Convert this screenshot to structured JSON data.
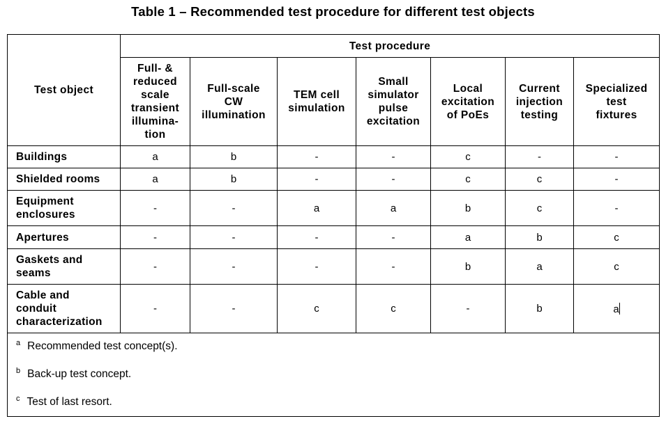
{
  "title": "Table 1 – Recommended test procedure for different test objects",
  "table": {
    "row_header_label": "Test object",
    "group_header_label": "Test procedure",
    "columns": [
      "Full- & reduced scale transient illumina-tion",
      "Full-scale CW illumination",
      "TEM cell simulation",
      "Small simulator pulse excitation",
      "Local excitation of PoEs",
      "Current injection testing",
      "Specialized test fixtures"
    ],
    "column_lines": [
      [
        "Full- &",
        "reduced",
        "scale",
        "transient",
        "illumina-",
        "tion"
      ],
      [
        "Full-scale",
        "CW",
        "illumination"
      ],
      [
        "TEM cell",
        "simulation"
      ],
      [
        "Small",
        "simulator",
        "pulse",
        "excitation"
      ],
      [
        "Local",
        "excitation",
        "of PoEs"
      ],
      [
        "Current",
        "injection",
        "testing"
      ],
      [
        "Specialized",
        "test",
        "fixtures"
      ]
    ],
    "rows": [
      {
        "object": "Buildings",
        "object_lines": [
          "Buildings"
        ],
        "values": [
          "a",
          "b",
          "-",
          "-",
          "c",
          "-",
          "-"
        ]
      },
      {
        "object": "Shielded rooms",
        "object_lines": [
          "Shielded rooms"
        ],
        "values": [
          "a",
          "b",
          "-",
          "-",
          "c",
          "c",
          "-"
        ]
      },
      {
        "object": "Equipment enclosures",
        "object_lines": [
          "Equipment",
          "enclosures"
        ],
        "values": [
          "-",
          "-",
          "a",
          "a",
          "b",
          "c",
          "-"
        ]
      },
      {
        "object": "Apertures",
        "object_lines": [
          "Apertures"
        ],
        "values": [
          "-",
          "-",
          "-",
          "-",
          "a",
          "b",
          "c"
        ]
      },
      {
        "object": "Gaskets and seams",
        "object_lines": [
          "Gaskets and",
          "seams"
        ],
        "values": [
          "-",
          "-",
          "-",
          "-",
          "b",
          "a",
          "c"
        ]
      },
      {
        "object": "Cable and conduit characterization",
        "object_lines": [
          "Cable and",
          "conduit",
          "characterization"
        ],
        "values": [
          "-",
          "-",
          "c",
          "c",
          "-",
          "b",
          "a"
        ]
      }
    ],
    "footnotes": [
      {
        "mark": "a",
        "text": "Recommended test concept(s)."
      },
      {
        "mark": "b",
        "text": "Back-up test concept."
      },
      {
        "mark": "c",
        "text": "Test of last resort."
      }
    ]
  }
}
